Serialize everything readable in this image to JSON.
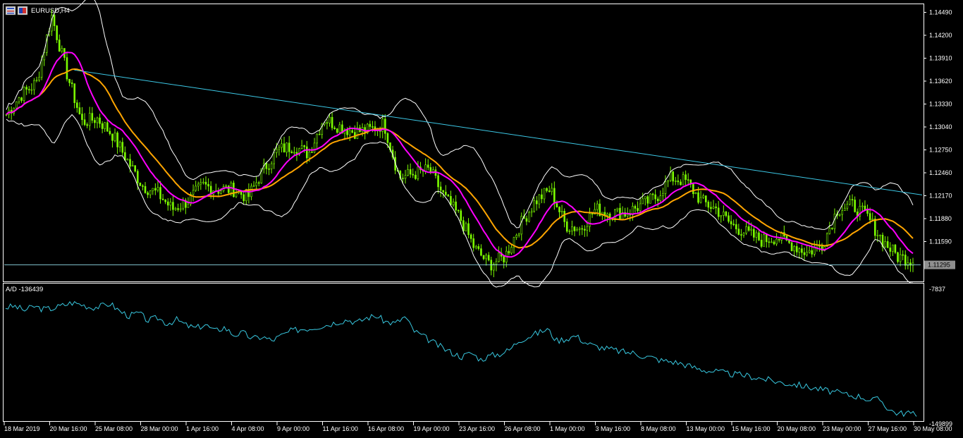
{
  "window": {
    "title": "EURUSD,H4",
    "colors": {
      "background": "#000000",
      "axis": "#ffffff",
      "candle": "#7cfc00",
      "ma_fast": "#ff00ff",
      "ma_slow": "#ffa500",
      "bands": "#ffffff",
      "trendline": "#3cc8e6",
      "price_line": "#8fd8e6",
      "ad_line": "#38c8e0"
    }
  },
  "chart_data": [
    {
      "type": "candlestick",
      "title": "EURUSD,H4",
      "ylim": [
        1.10864,
        1.1458
      ],
      "y_ticks": [
        "1.14490",
        "1.14200",
        "1.13910",
        "1.13620",
        "1.13330",
        "1.13040",
        "1.12750",
        "1.12460",
        "1.12170",
        "1.11880",
        "1.11590"
      ],
      "current_price_label": "1.11295",
      "current_price": 1.11295,
      "trendline": [
        {
          "x": "20 Mar 16:00",
          "y": 1.1376
        },
        {
          "x": "30 May 08:00",
          "y": 1.1218
        }
      ],
      "price_path": [
        {
          "x": "18 Mar 2019",
          "y": 1.132
        },
        {
          "x": "19 Mar",
          "y": 1.1345
        },
        {
          "x": "20 Mar",
          "y": 1.136
        },
        {
          "x": "20 Mar 16:00",
          "y": 1.1445
        },
        {
          "x": "21 Mar",
          "y": 1.1372
        },
        {
          "x": "22 Mar",
          "y": 1.131
        },
        {
          "x": "25 Mar 08:00",
          "y": 1.1315
        },
        {
          "x": "26 Mar",
          "y": 1.1295
        },
        {
          "x": "27 Mar",
          "y": 1.1262
        },
        {
          "x": "28 Mar 00:00",
          "y": 1.123
        },
        {
          "x": "29 Mar",
          "y": 1.122
        },
        {
          "x": "1 Apr",
          "y": 1.12
        },
        {
          "x": "1 Apr 16:00",
          "y": 1.121
        },
        {
          "x": "2 Apr",
          "y": 1.123
        },
        {
          "x": "3 Apr",
          "y": 1.1225
        },
        {
          "x": "4 Apr 08:00",
          "y": 1.1225
        },
        {
          "x": "5 Apr",
          "y": 1.1215
        },
        {
          "x": "8 Apr",
          "y": 1.125
        },
        {
          "x": "9 Apr 00:00",
          "y": 1.1275
        },
        {
          "x": "10 Apr",
          "y": 1.128
        },
        {
          "x": "11 Apr",
          "y": 1.127
        },
        {
          "x": "11 Apr 16:00",
          "y": 1.1315
        },
        {
          "x": "12 Apr",
          "y": 1.1305
        },
        {
          "x": "15 Apr",
          "y": 1.1298
        },
        {
          "x": "16 Apr 08:00",
          "y": 1.13
        },
        {
          "x": "17 Apr",
          "y": 1.1308
        },
        {
          "x": "18 Apr",
          "y": 1.124
        },
        {
          "x": "19 Apr 00:00",
          "y": 1.1245
        },
        {
          "x": "22 Apr",
          "y": 1.125
        },
        {
          "x": "23 Apr",
          "y": 1.1215
        },
        {
          "x": "23 Apr 16:00",
          "y": 1.119
        },
        {
          "x": "24 Apr",
          "y": 1.115
        },
        {
          "x": "25 Apr",
          "y": 1.113
        },
        {
          "x": "26 Apr 08:00",
          "y": 1.114
        },
        {
          "x": "29 Apr",
          "y": 1.118
        },
        {
          "x": "30 Apr",
          "y": 1.121
        },
        {
          "x": "1 May 00:00",
          "y": 1.1225
        },
        {
          "x": "2 May",
          "y": 1.118
        },
        {
          "x": "3 May",
          "y": 1.1175
        },
        {
          "x": "3 May 16:00",
          "y": 1.12
        },
        {
          "x": "6 May",
          "y": 1.1195
        },
        {
          "x": "7 May",
          "y": 1.1195
        },
        {
          "x": "8 May 08:00",
          "y": 1.1205
        },
        {
          "x": "9 May",
          "y": 1.1215
        },
        {
          "x": "10 May",
          "y": 1.124
        },
        {
          "x": "13 May 00:00",
          "y": 1.1235
        },
        {
          "x": "14 May",
          "y": 1.121
        },
        {
          "x": "15 May",
          "y": 1.12
        },
        {
          "x": "15 May 16:00",
          "y": 1.118
        },
        {
          "x": "16 May",
          "y": 1.117
        },
        {
          "x": "17 May",
          "y": 1.116
        },
        {
          "x": "20 May 08:00",
          "y": 1.1165
        },
        {
          "x": "21 May",
          "y": 1.1155
        },
        {
          "x": "22 May",
          "y": 1.1145
        },
        {
          "x": "23 May 00:00",
          "y": 1.1155
        },
        {
          "x": "24 May",
          "y": 1.12
        },
        {
          "x": "27 May",
          "y": 1.1205
        },
        {
          "x": "27 May 16:00",
          "y": 1.119
        },
        {
          "x": "28 May",
          "y": 1.116
        },
        {
          "x": "29 May",
          "y": 1.114
        },
        {
          "x": "30 May 08:00",
          "y": 1.1135
        }
      ],
      "x_ticks": [
        "18 Mar 2019",
        "20 Mar 16:00",
        "25 Mar 08:00",
        "28 Mar 00:00",
        "1 Apr 16:00",
        "4 Apr 08:00",
        "9 Apr 00:00",
        "11 Apr 16:00",
        "16 Apr 08:00",
        "19 Apr 00:00",
        "23 Apr 16:00",
        "26 Apr 08:00",
        "1 May 00:00",
        "3 May 16:00",
        "8 May 08:00",
        "13 May 00:00",
        "15 May 16:00",
        "20 May 08:00",
        "23 May 00:00",
        "27 May 16:00",
        "30 May 08:00"
      ]
    },
    {
      "type": "line",
      "title": "A/D -136439",
      "ylim": [
        -149899,
        -7837
      ],
      "y_ticks": [
        "-7837",
        "-149899"
      ],
      "series": [
        {
          "values": [
            -27000,
            -26000,
            -30000,
            -26000,
            -29000,
            -28000,
            -25000,
            -22000,
            -24000,
            -27000,
            -26000,
            -23000,
            -31000,
            -36000,
            -33000,
            -41000,
            -38000,
            -44000,
            -40000,
            -46000,
            -49000,
            -45000,
            -52000,
            -48000,
            -56000,
            -54000,
            -60000,
            -58000,
            -62000,
            -57000,
            -52000,
            -50000,
            -49000,
            -47000,
            -45000,
            -42000,
            -40000,
            -43000,
            -38000,
            -36000,
            -42000,
            -44000,
            -37000,
            -52000,
            -58000,
            -64000,
            -70000,
            -75000,
            -79000,
            -75000,
            -82000,
            -78000,
            -76000,
            -72000,
            -62000,
            -58000,
            -54000,
            -50000,
            -62000,
            -60000,
            -57000,
            -64000,
            -68000,
            -70000,
            -72000,
            -74000,
            -75000,
            -78000,
            -80000,
            -83000,
            -84000,
            -86000,
            -89000,
            -92000,
            -94000,
            -95000,
            -97000,
            -98000,
            -99000,
            -101000,
            -103000,
            -105000,
            -107000,
            -108000,
            -110000,
            -112000,
            -114000,
            -116000,
            -118000,
            -120000,
            -121000,
            -125000,
            -124000,
            -135000,
            -139000,
            -138000,
            -142000
          ]
        }
      ],
      "x": [
        "18 Mar 2019",
        "20 Mar 16:00",
        "25 Mar 08:00",
        "28 Mar 00:00",
        "1 Apr 16:00",
        "4 Apr 08:00",
        "9 Apr 00:00",
        "11 Apr 16:00",
        "16 Apr 08:00",
        "19 Apr 00:00",
        "23 Apr 16:00",
        "26 Apr 08:00",
        "1 May 00:00",
        "3 May 16:00",
        "8 May 08:00",
        "13 May 00:00",
        "15 May 16:00",
        "20 May 08:00",
        "23 May 00:00",
        "27 May 16:00",
        "30 May 08:00"
      ]
    }
  ]
}
